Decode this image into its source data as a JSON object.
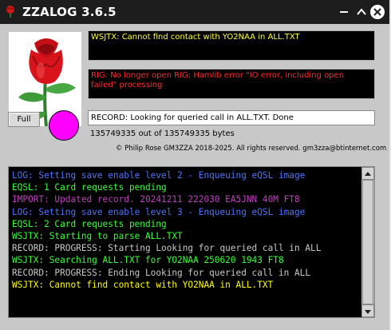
{
  "window": {
    "title": "ZZALOG 3.6.5"
  },
  "messages": {
    "wsjtx_status": "WSJTX: Cannot find contact with YO2NAA in ALL.TXT",
    "rig_status": "RIG: No longer open RIG: Hamlib error \"IO error, including open failed\" processing",
    "record_status": "RECORD: Looking for queried call in ALL.TXT. Done",
    "progress_text": "135749335 out of 135749335 bytes",
    "copyright": "© Philip Rose GM3ZZA 2018-2025. All rights reserved. gm3zza@btinternet.com"
  },
  "controls": {
    "full_label": "Full"
  },
  "colors": {
    "indicator": "#ff00ff",
    "yellow": "#ffff3b",
    "red": "#ff2b2b",
    "blue": "#4d73ff",
    "green": "#39ff39",
    "grey": "#c8c8c8",
    "purple": "#c040c0",
    "yellow_log": "#ffff00"
  },
  "log": [
    {
      "text": "LOG: Setting save enable level 2 - Enqueuing eQSL image",
      "color": "#4d73ff"
    },
    {
      "text": "EQSL: 1 Card requests pending",
      "color": "#39ff39"
    },
    {
      "text": "IMPORT: Updated record. 20241211 222030 EA5JNN 40M FT8",
      "color": "#c040c0"
    },
    {
      "text": "LOG: Setting save enable level 3 - Enqueuing eQSL image",
      "color": "#4d73ff"
    },
    {
      "text": "EQSL: 2 Card requests pending",
      "color": "#39ff39"
    },
    {
      "text": "WSJTX: Starting to parse ALL.TXT",
      "color": "#39ff39"
    },
    {
      "text": "RECORD: PROGRESS: Starting Looking for queried call in ALL",
      "color": "#c8c8c8"
    },
    {
      "text": "WSJTX: Searching ALL.TXT for YO2NAA 250620 1943 FT8",
      "color": "#39ff39"
    },
    {
      "text": "RECORD: PROGRESS: Ending Looking for queried call in ALL",
      "color": "#c8c8c8"
    },
    {
      "text": "WSJTX: Cannot find contact with YO2NAA in ALL.TXT",
      "color": "#ffff00"
    }
  ]
}
